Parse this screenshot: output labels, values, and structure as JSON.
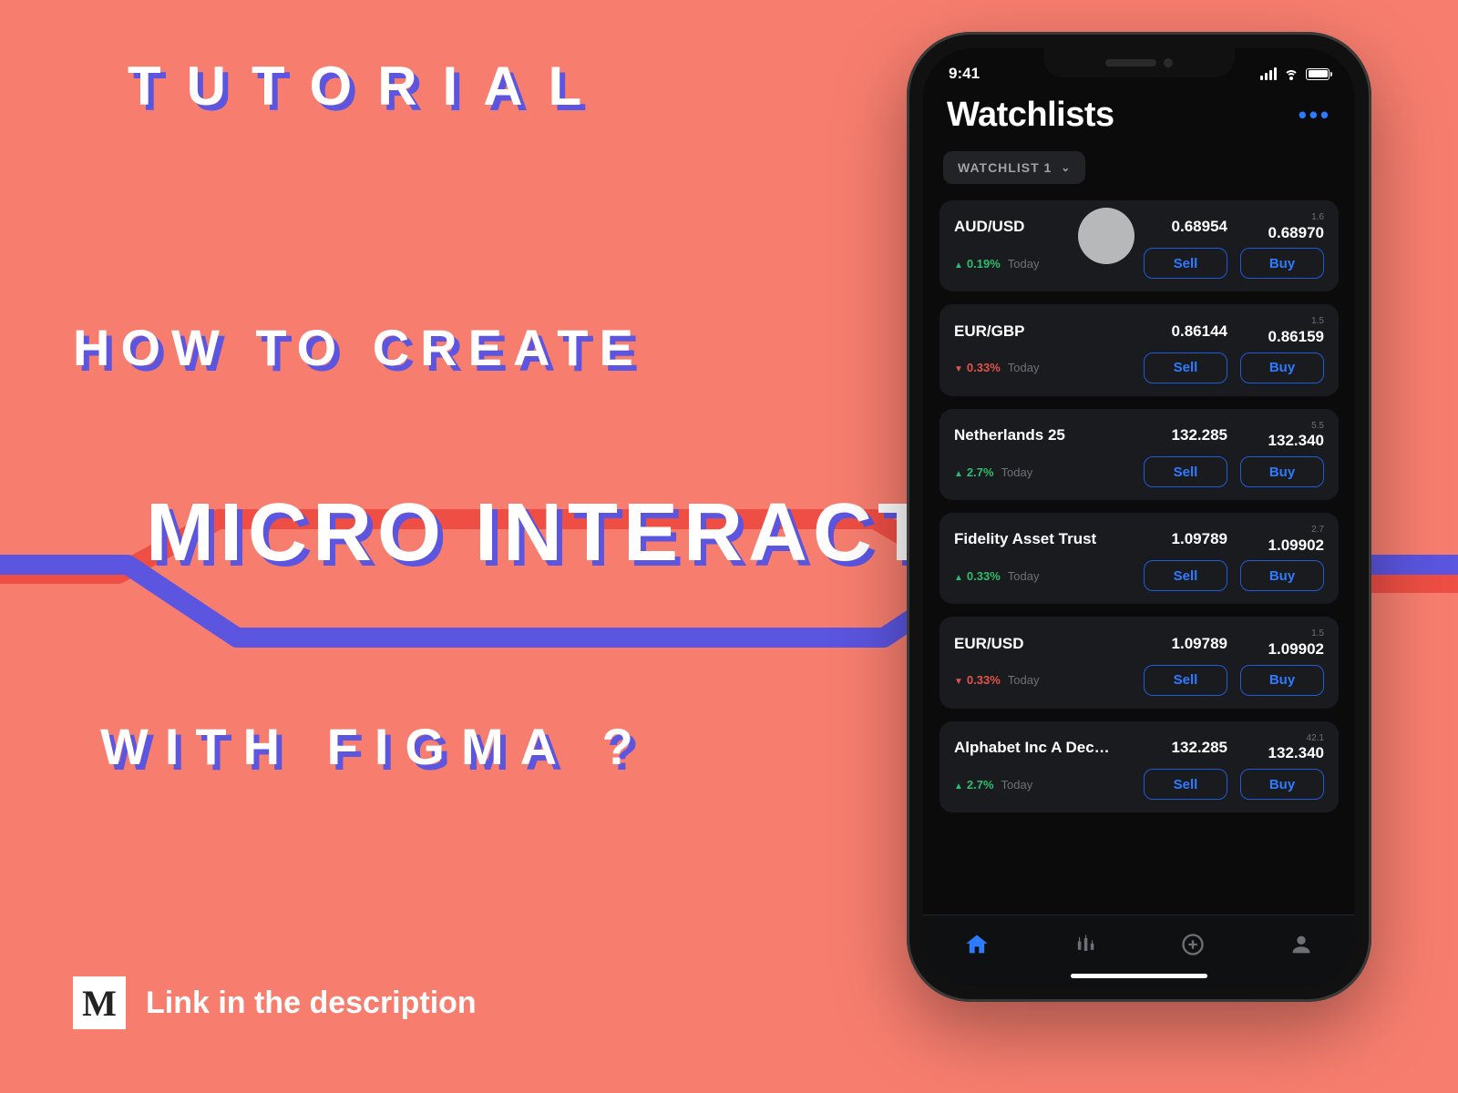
{
  "hero": {
    "line1": "TUTORIAL",
    "line2": "HOW TO CREATE",
    "line3": "MICRO INTERACTIONS",
    "line4": "WITH FIGMA ?"
  },
  "cta": {
    "icon_letter": "M",
    "text": "Link in the description"
  },
  "phone": {
    "time": "9:41",
    "page_title": "Watchlists",
    "more": "•••",
    "selector": {
      "label": "WATCHLIST 1",
      "chevron": "⌄"
    },
    "buttons": {
      "sell": "Sell",
      "buy": "Buy"
    },
    "today": "Today",
    "items": [
      {
        "symbol": "AUD/USD",
        "sell": "0.68954",
        "buy": "0.68970",
        "change": "0.19%",
        "dir": "up",
        "pips": "1.6"
      },
      {
        "symbol": "EUR/GBP",
        "sell": "0.86144",
        "buy": "0.86159",
        "change": "0.33%",
        "dir": "down",
        "pips": "1.5"
      },
      {
        "symbol": "Netherlands 25",
        "sell": "132.285",
        "buy": "132.340",
        "change": "2.7%",
        "dir": "up",
        "pips": "5.5"
      },
      {
        "symbol": "Fidelity Asset Trust",
        "sell": "1.09789",
        "buy": "1.09902",
        "change": "0.33%",
        "dir": "up",
        "pips": "2.7"
      },
      {
        "symbol": "EUR/USD",
        "sell": "1.09789",
        "buy": "1.09902",
        "change": "0.33%",
        "dir": "down",
        "pips": "1.5"
      },
      {
        "symbol": "Alphabet Inc A Dec…",
        "sell": "132.285",
        "buy": "132.340",
        "change": "2.7%",
        "dir": "up",
        "pips": "42.1"
      }
    ]
  }
}
